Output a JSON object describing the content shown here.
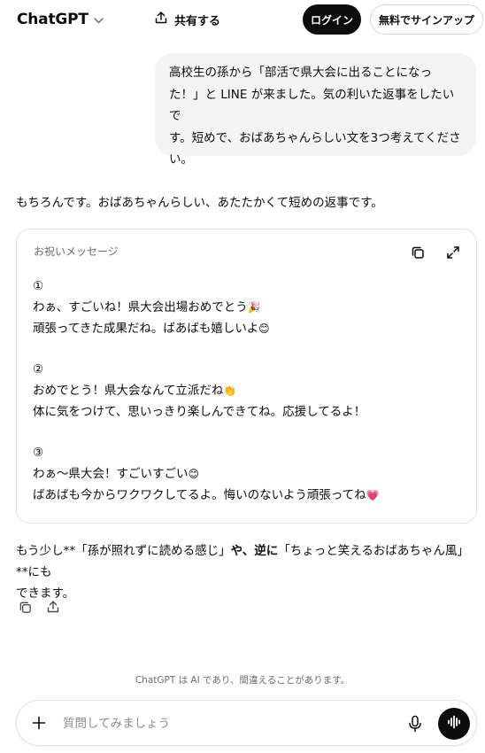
{
  "header": {
    "brand": "ChatGPT",
    "brand_chevron": "⌵",
    "share_label": "共有する",
    "login_label": "ログイン",
    "signup_label": "無料でサインアップ"
  },
  "conversation": {
    "user_message_lines": [
      "高校生の孫から「部活で県大会に出ることになっ",
      "た！」と LINE が来ました。気の利いた返事をしたいで",
      "す。短めで、おばあちゃんらしい文を3つ考えてくださ",
      "い。"
    ],
    "assistant_intro": "もちろんです。おばあちゃんらしい、あたたかくて短めの返事です。",
    "card": {
      "title": "お祝いメッセージ",
      "messages": [
        {
          "number": "①",
          "line1": "わぁ、すごいね！県大会出場おめでとう",
          "emoji1": "🎉",
          "line2": "頑張ってきた成果だね。ばあばも嬉しいよ",
          "emoji2": "😊"
        },
        {
          "number": "②",
          "line1": "おめでとう！県大会なんて立派だね",
          "emoji1": "👏",
          "line2": "体に気をつけて、思いっきり楽しんできてね。応援してるよ！",
          "emoji2": ""
        },
        {
          "number": "③",
          "line1": "わぁ〜県大会！すごいすごい",
          "emoji1": "😊",
          "line2": "ばあばも今からワクワクしてるよ。悔いのないよう頑張ってね",
          "emoji2": "💗"
        }
      ]
    },
    "followup": {
      "p1": "もう少し**「孫が照れずに読める感じ」",
      "p2": "や、",
      "p3": "逆に",
      "p4": "「ちょっと笑えるおばあちゃん風」**にも",
      "line2": "できます。"
    }
  },
  "composer": {
    "placeholder": "質問してみましょう"
  },
  "disclaimer": "ChatGPT は AI であり、間違えることがあります。",
  "icons": {
    "share": "share-upload-icon",
    "copy": "copy-icon",
    "expand": "expand-icon",
    "plus": "plus-icon",
    "mic": "microphone-icon",
    "voice": "voice-waveform-icon"
  },
  "colors": {
    "primary_dark": "#0d0d0d",
    "bubble_bg": "#f4f4f4",
    "muted_text": "#6b6b6b",
    "border": "#e3e3e3",
    "emoji_heart": "#e8326d"
  }
}
